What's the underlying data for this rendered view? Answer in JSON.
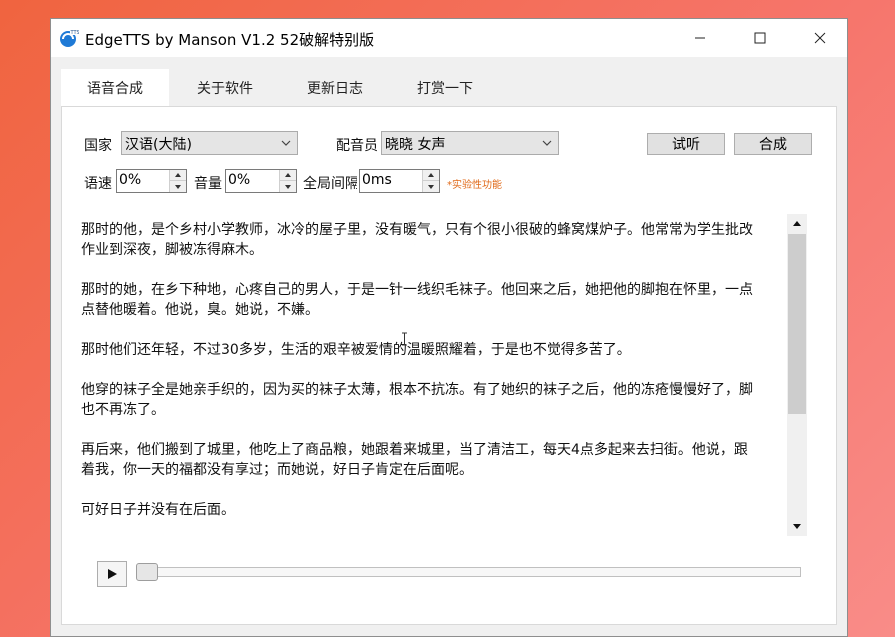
{
  "window": {
    "title": "EdgeTTS by Manson V1.2 52破解特别版",
    "icon": "tts-app-icon",
    "controls": [
      "minimize-icon",
      "maximize-icon",
      "close-icon"
    ]
  },
  "tabs": [
    {
      "label": "语音合成",
      "active": true
    },
    {
      "label": "关于软件",
      "active": false
    },
    {
      "label": "更新日志",
      "active": false
    },
    {
      "label": "打赏一下",
      "active": false
    }
  ],
  "form": {
    "country_label": "国家",
    "country_value": "汉语(大陆)",
    "voice_label": "配音员",
    "voice_value": "晓晓 女声",
    "preview_button": "试听",
    "synthesize_button": "合成",
    "rate_label": "语速",
    "rate_value": "0%",
    "volume_label": "音量",
    "volume_value": "0%",
    "pause_label": "全局间隔",
    "pause_value": "0ms",
    "experimental_note": "*实验性功能"
  },
  "text_content": [
    "那时的他，是个乡村小学教师，冰冷的屋子里，没有暖气，只有个很小很破的蜂窝煤炉子。他常常为学生批改作业到深夜，脚被冻得麻木。",
    "那时的她，在乡下种地，心疼自己的男人，于是一针一线织毛袜子。他回来之后，她把他的脚抱在怀里，一点点替他暖着。他说，臭。她说，不嫌。",
    "那时他们还年轻，不过30多岁，生活的艰辛被爱情的温暖照耀着，于是也不觉得多苦了。",
    "他穿的袜子全是她亲手织的，因为买的袜子太薄，根本不抗冻。有了她织的袜子之后，他的冻疮慢慢好了，脚也不再冻了。",
    "再后来，他们搬到了城里，他吃上了商品粮，她跟着来城里，当了清洁工，每天4点多起来去扫街。他说，跟着我，你一天的福都没有享过；而她说，好日子肯定在后面呢。",
    "可好日子并没有在后面。"
  ],
  "player": {
    "play_icon": "play-icon",
    "progress": 0
  },
  "colors": {
    "background_gradient_start": "#f0643f",
    "background_gradient_end": "#f98c88",
    "note_color": "#e06a1a"
  }
}
